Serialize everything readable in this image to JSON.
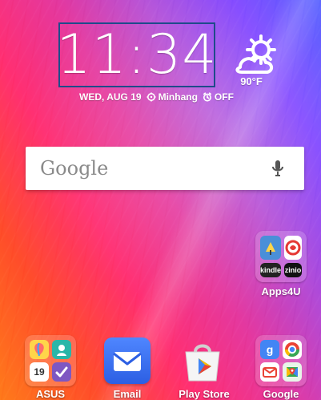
{
  "status": {
    "time": "11:34",
    "date_text": "WED, AUG 19",
    "location": "Minhang",
    "alarm": "OFF",
    "temperature": "90°F"
  },
  "search": {
    "brand": "Google"
  },
  "apps": [
    {
      "name": "Apps4U"
    },
    {
      "name": "ASUS"
    },
    {
      "name": "Email"
    },
    {
      "name": "Play Store"
    },
    {
      "name": "Google"
    }
  ],
  "mini_labels": {
    "asus_calendar_day": "19",
    "apps4u_kindle": "kindle",
    "apps4u_zinio": "zinio",
    "google_g": "g"
  },
  "icons": {
    "weather": "partly-cloudy-sun-icon",
    "location": "location-pin-icon",
    "alarm": "alarm-clock-icon",
    "mic": "microphone-icon",
    "email": "envelope-icon",
    "play_store": "play-store-icon"
  },
  "colors": {
    "clock_outline": "#1f4b8a",
    "search_bg": "#ffffff",
    "email_blue": "#2c5fe3",
    "google_blue": "#4285F4",
    "google_red": "#EA4335",
    "google_yellow": "#FBBC05",
    "google_green": "#34A853"
  }
}
